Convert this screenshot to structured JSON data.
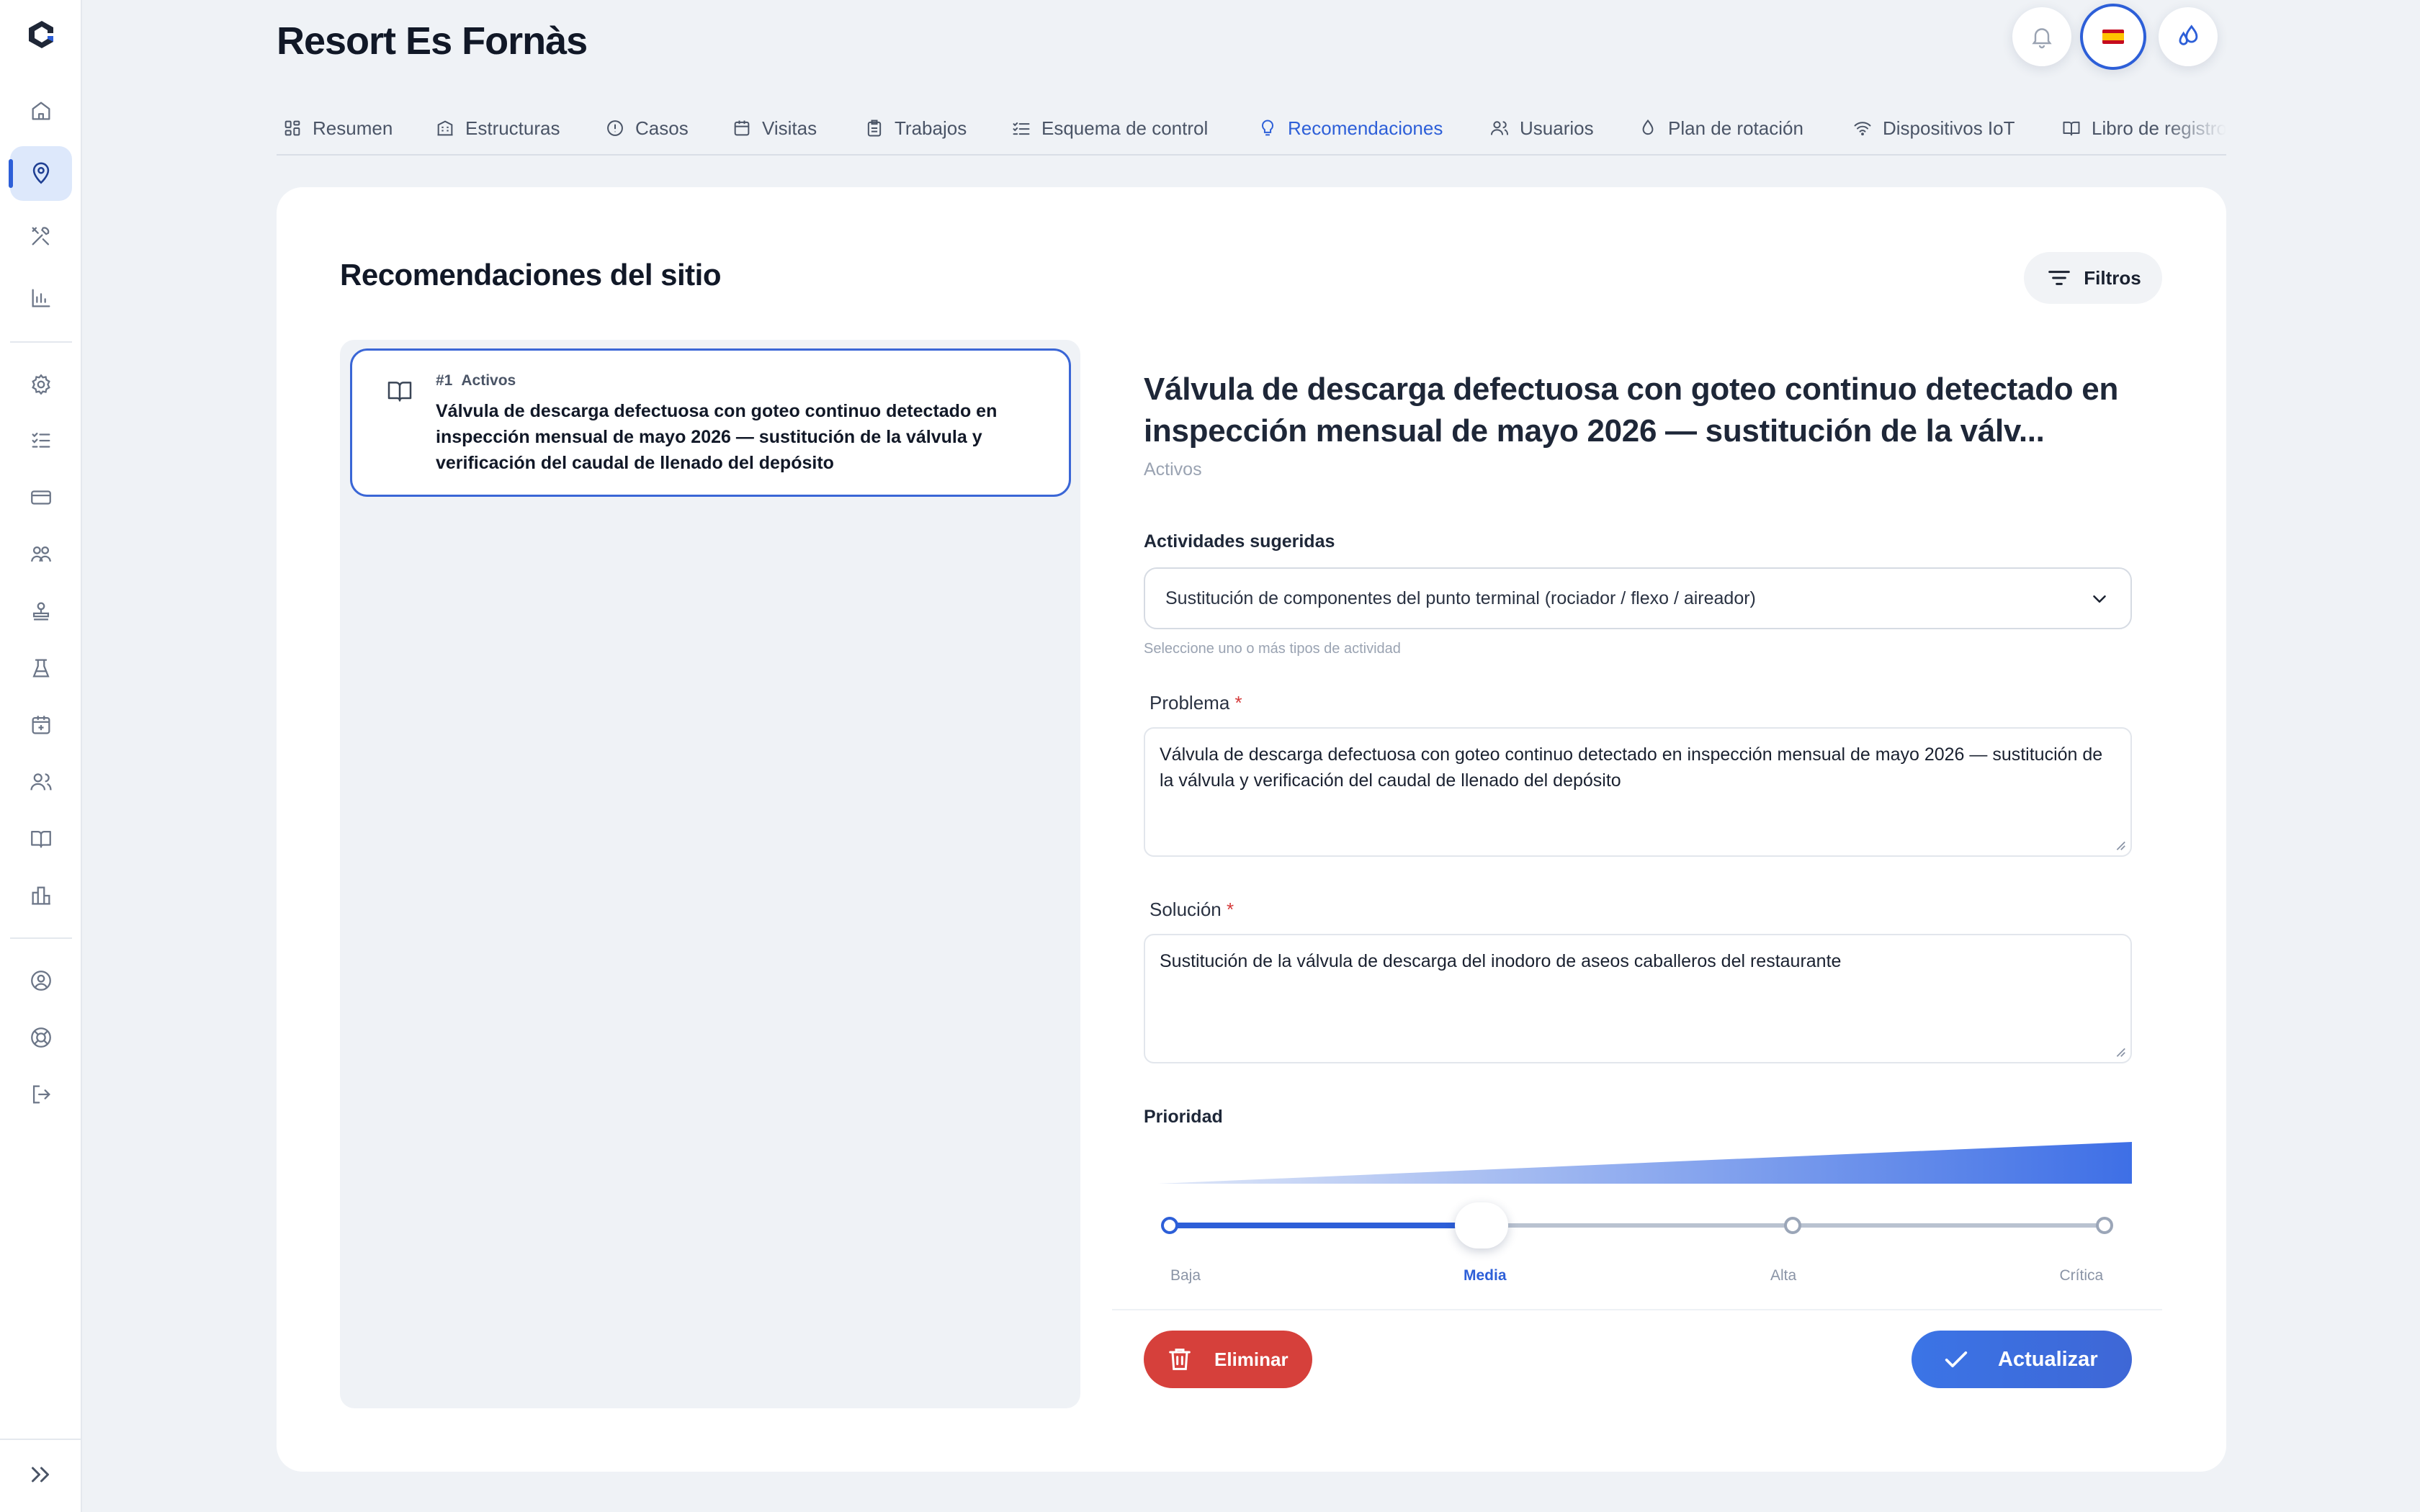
{
  "app": {
    "site_title": "Resort Es Fornàs",
    "language_flag": "es"
  },
  "sidebar": {
    "items": [
      {
        "icon": "home-icon"
      },
      {
        "icon": "map-pin-icon",
        "active": true
      },
      {
        "icon": "tools-icon"
      },
      {
        "icon": "bar-chart-icon"
      },
      {
        "icon": "gear-icon"
      },
      {
        "icon": "checklist-icon"
      },
      {
        "icon": "card-icon"
      },
      {
        "icon": "team-icon"
      },
      {
        "icon": "stamp-icon"
      },
      {
        "icon": "flask-icon"
      },
      {
        "icon": "calendar-plus-icon"
      },
      {
        "icon": "users-icon"
      },
      {
        "icon": "book-icon"
      },
      {
        "icon": "building-icon"
      },
      {
        "icon": "user-circle-icon"
      },
      {
        "icon": "lifebuoy-icon"
      },
      {
        "icon": "logout-icon"
      }
    ],
    "expand_icon": "chevrons-right-icon"
  },
  "tabs": [
    {
      "label": "Resumen",
      "icon": "grid-icon"
    },
    {
      "label": "Estructuras",
      "icon": "building-icon"
    },
    {
      "label": "Casos",
      "icon": "alert-circle-icon"
    },
    {
      "label": "Visitas",
      "icon": "calendar-icon"
    },
    {
      "label": "Trabajos",
      "icon": "clipboard-icon"
    },
    {
      "label": "Esquema de control",
      "icon": "list-check-icon"
    },
    {
      "label": "Recomendaciones",
      "icon": "lightbulb-icon",
      "active": true
    },
    {
      "label": "Usuarios",
      "icon": "users-icon"
    },
    {
      "label": "Plan de rotación",
      "icon": "drop-icon"
    },
    {
      "label": "Dispositivos IoT",
      "icon": "wifi-icon"
    },
    {
      "label": "Libro de registro",
      "icon": "book-icon"
    }
  ],
  "section": {
    "title": "Recomendaciones del sitio",
    "filters_label": "Filtros"
  },
  "list": {
    "items": [
      {
        "number": "#1",
        "category": "Activos",
        "text": "Válvula de descarga defectuosa con goteo continuo detectado en inspección mensual de mayo 2026 — sustitución de la válvula y verificación del caudal de llenado del depósito"
      }
    ]
  },
  "detail": {
    "title": "Válvula de descarga defectuosa con goteo continuo detectado en inspección mensual de mayo 2026 — sustitución de la válv...",
    "category": "Activos",
    "activities_label": "Actividades sugeridas",
    "activities_value": "Sustitución de componentes del punto terminal (rociador / flexo / aireador)",
    "activities_hint": "Seleccione uno o más tipos de actividad",
    "problem_label": "Problema",
    "problem_value": "Válvula de descarga defectuosa con goteo continuo detectado en inspección mensual de mayo 2026 — sustitución de la válvula y verificación del caudal de llenado del depósito",
    "solution_label": "Solución",
    "solution_value": "Sustitución de la válvula de descarga del inodoro de aseos caballeros del restaurante",
    "required_mark": "*",
    "priority_label": "Prioridad",
    "priority_levels": [
      "Baja",
      "Media",
      "Alta",
      "Crítica"
    ],
    "priority_selected": "Media",
    "priority_index": 1,
    "delete_label": "Eliminar",
    "update_label": "Actualizar"
  },
  "colors": {
    "accent": "#2d5fd8",
    "danger": "#d6403b",
    "background": "#eff2f6"
  }
}
